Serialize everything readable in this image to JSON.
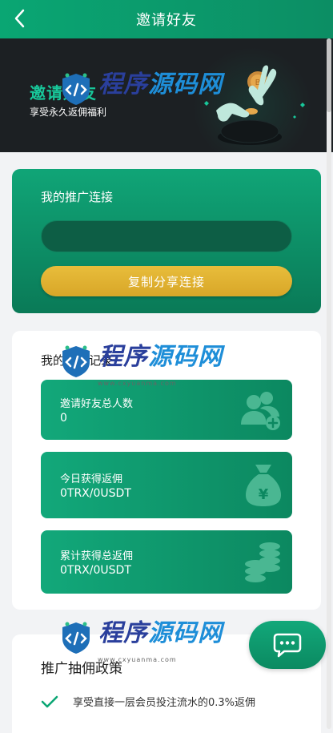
{
  "header": {
    "title": "邀请好友"
  },
  "banner": {
    "title": "邀请好友",
    "subtitle": "享受永久返佣福利"
  },
  "link_card": {
    "label": "我的推广连接",
    "input_value": "",
    "copy_button": "复制分享连接"
  },
  "records": {
    "title": "我的邀请记录",
    "stats": [
      {
        "label": "邀请好友总人数",
        "value": "0",
        "icon": "users-add-icon"
      },
      {
        "label": "今日获得返佣",
        "value": "0TRX/0USDT",
        "icon": "money-bag-icon"
      },
      {
        "label": "累计获得总返佣",
        "value": "0TRX/0USDT",
        "icon": "coin-stack-icon"
      }
    ]
  },
  "policy": {
    "title": "推广抽佣政策",
    "items": [
      {
        "text": "享受直接一层会员投注流水的0.3%返佣"
      }
    ]
  },
  "watermark": {
    "text_a": "程序",
    "text_b": "源码网",
    "url": "www.cxyuanma.com"
  },
  "colors": {
    "primary": "#0aa673",
    "gold": "#e2b331",
    "banner_bg": "#1c2023"
  }
}
